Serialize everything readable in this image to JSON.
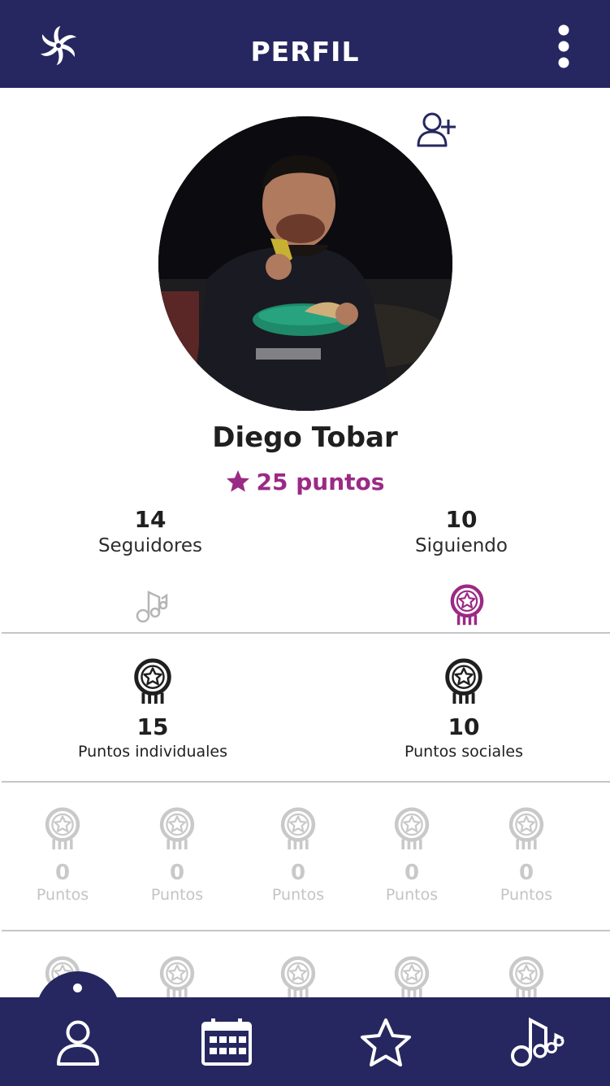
{
  "header": {
    "title": "PERFIL",
    "logo_icon": "pinwheel-logo-icon",
    "menu_icon": "more-vertical-icon"
  },
  "profile": {
    "add_friend_icon": "add-user-icon",
    "name": "Diego Tobar",
    "points_text": "25 puntos",
    "points_icon": "star-icon"
  },
  "stats": [
    {
      "value": "14",
      "label": "Seguidores"
    },
    {
      "value": "10",
      "label": "Siguiendo"
    }
  ],
  "tabs": [
    {
      "icon": "music-notes-icon",
      "active": false
    },
    {
      "icon": "medal-icon",
      "active": true
    }
  ],
  "summary": [
    {
      "value": "15",
      "label": "Puntos individuales",
      "icon": "medal-icon"
    },
    {
      "value": "10",
      "label": "Puntos sociales",
      "icon": "medal-icon"
    }
  ],
  "badges_row1": [
    {
      "value": "0",
      "label": "Puntos"
    },
    {
      "value": "0",
      "label": "Puntos"
    },
    {
      "value": "0",
      "label": "Puntos"
    },
    {
      "value": "0",
      "label": "Puntos"
    },
    {
      "value": "0",
      "label": "Puntos"
    }
  ],
  "bottom_nav": [
    {
      "icon": "user-icon",
      "active": true
    },
    {
      "icon": "calendar-icon",
      "active": false
    },
    {
      "icon": "star-icon",
      "active": false
    },
    {
      "icon": "music-notes-icon",
      "active": false
    }
  ],
  "colors": {
    "primary": "#262760",
    "accent": "#9b2a85",
    "muted": "#c4c4c4",
    "text": "#1f1f1f"
  }
}
